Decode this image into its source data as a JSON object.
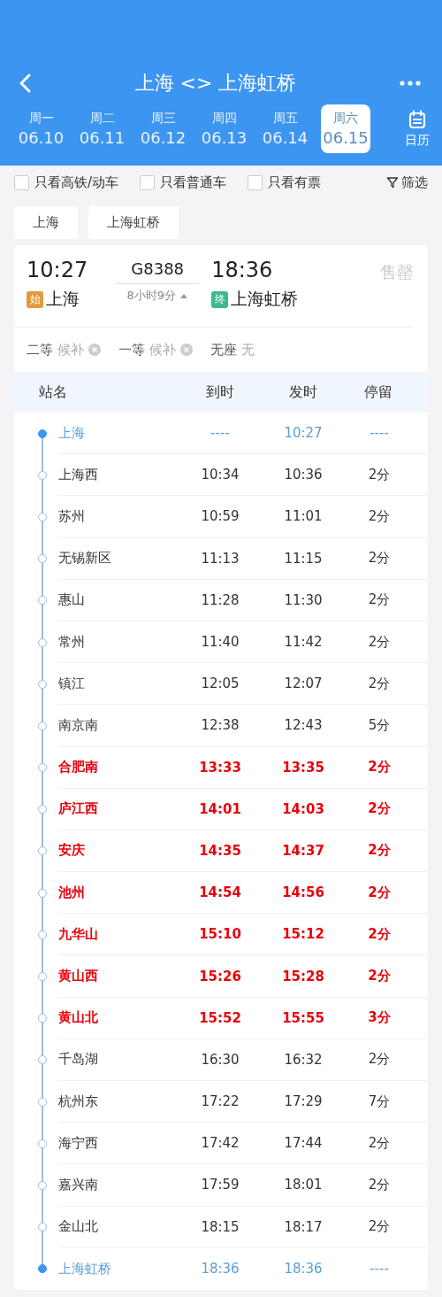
{
  "header": {
    "title": "上海 <> 上海虹桥",
    "calendar_label": "日历"
  },
  "days": [
    {
      "weekday": "周一",
      "date": "06.10",
      "selected": false
    },
    {
      "weekday": "周二",
      "date": "06.11",
      "selected": false
    },
    {
      "weekday": "周三",
      "date": "06.12",
      "selected": false
    },
    {
      "weekday": "周四",
      "date": "06.13",
      "selected": false
    },
    {
      "weekday": "周五",
      "date": "06.14",
      "selected": false
    },
    {
      "weekday": "周六",
      "date": "06.15",
      "selected": true
    }
  ],
  "filters": [
    {
      "label": "只看高铁/动车",
      "checked": false
    },
    {
      "label": "只看普通车",
      "checked": false
    },
    {
      "label": "只看有票",
      "checked": false
    }
  ],
  "filter_button": "筛选",
  "station_tags": [
    "上海",
    "上海虹桥"
  ],
  "train": {
    "depart_time": "10:27",
    "number": "G8388",
    "arrive_time": "18:36",
    "status": "售罄",
    "from_badge": "始",
    "from": "上海",
    "duration": "8小时9分",
    "to_badge": "终",
    "to": "上海虹桥",
    "expanded": true
  },
  "seats": [
    {
      "class": "二等",
      "availability": "候补",
      "closed": true
    },
    {
      "class": "一等",
      "availability": "候补",
      "closed": true
    },
    {
      "class": "无座",
      "availability": "无",
      "closed": false
    }
  ],
  "columns": [
    "站名",
    "到时",
    "发时",
    "停留"
  ],
  "stops": [
    {
      "kind": "end",
      "station": "上海",
      "arrive": "----",
      "depart": "10:27",
      "stay": "----"
    },
    {
      "kind": "normal",
      "station": "上海西",
      "arrive": "10:34",
      "depart": "10:36",
      "stay": "2分"
    },
    {
      "kind": "normal",
      "station": "苏州",
      "arrive": "10:59",
      "depart": "11:01",
      "stay": "2分"
    },
    {
      "kind": "normal",
      "station": "无锡新区",
      "arrive": "11:13",
      "depart": "11:15",
      "stay": "2分"
    },
    {
      "kind": "normal",
      "station": "惠山",
      "arrive": "11:28",
      "depart": "11:30",
      "stay": "2分"
    },
    {
      "kind": "normal",
      "station": "常州",
      "arrive": "11:40",
      "depart": "11:42",
      "stay": "2分"
    },
    {
      "kind": "normal",
      "station": "镇江",
      "arrive": "12:05",
      "depart": "12:07",
      "stay": "2分"
    },
    {
      "kind": "normal",
      "station": "南京南",
      "arrive": "12:38",
      "depart": "12:43",
      "stay": "5分"
    },
    {
      "kind": "highlight",
      "station": "合肥南",
      "arrive": "13:33",
      "depart": "13:35",
      "stay": "2分"
    },
    {
      "kind": "highlight",
      "station": "庐江西",
      "arrive": "14:01",
      "depart": "14:03",
      "stay": "2分"
    },
    {
      "kind": "highlight",
      "station": "安庆",
      "arrive": "14:35",
      "depart": "14:37",
      "stay": "2分"
    },
    {
      "kind": "highlight",
      "station": "池州",
      "arrive": "14:54",
      "depart": "14:56",
      "stay": "2分"
    },
    {
      "kind": "highlight",
      "station": "九华山",
      "arrive": "15:10",
      "depart": "15:12",
      "stay": "2分"
    },
    {
      "kind": "highlight",
      "station": "黄山西",
      "arrive": "15:26",
      "depart": "15:28",
      "stay": "2分"
    },
    {
      "kind": "highlight",
      "station": "黄山北",
      "arrive": "15:52",
      "depart": "15:55",
      "stay": "3分"
    },
    {
      "kind": "normal",
      "station": "千岛湖",
      "arrive": "16:30",
      "depart": "16:32",
      "stay": "2分"
    },
    {
      "kind": "normal",
      "station": "杭州东",
      "arrive": "17:22",
      "depart": "17:29",
      "stay": "7分"
    },
    {
      "kind": "normal",
      "station": "海宁西",
      "arrive": "17:42",
      "depart": "17:44",
      "stay": "2分"
    },
    {
      "kind": "normal",
      "station": "嘉兴南",
      "arrive": "17:59",
      "depart": "18:01",
      "stay": "2分"
    },
    {
      "kind": "normal",
      "station": "金山北",
      "arrive": "18:15",
      "depart": "18:17",
      "stay": "2分"
    },
    {
      "kind": "end",
      "station": "上海虹桥",
      "arrive": "18:36",
      "depart": "18:36",
      "stay": "----"
    }
  ]
}
